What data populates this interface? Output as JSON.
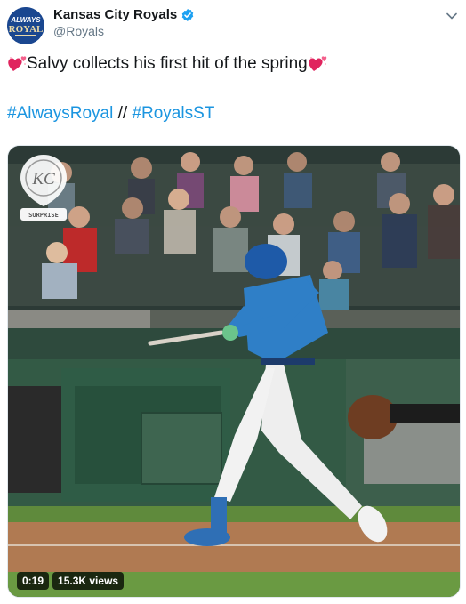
{
  "account": {
    "display_name": "Kansas City Royals",
    "handle": "@Royals",
    "avatar_text_1": "ALWAYS",
    "avatar_text_2": "ROYAL",
    "verified": true
  },
  "tweet": {
    "text_line": "Salvy collects his first hit of the spring",
    "hashtag_1": "#AlwaysRoyal",
    "separator": "//",
    "hashtag_2": "#RoyalsST"
  },
  "media": {
    "badge_logo": "KC",
    "badge_label": "SURPRISE",
    "duration": "0:19",
    "views": "15.3K views"
  },
  "colors": {
    "link": "#1b95e0",
    "royal_blue": "#1a4790",
    "verified": "#1da1f2",
    "heart": "#e0245e"
  },
  "icons": [
    "verified-icon",
    "caret-down-icon",
    "sparkling-heart-icon"
  ]
}
